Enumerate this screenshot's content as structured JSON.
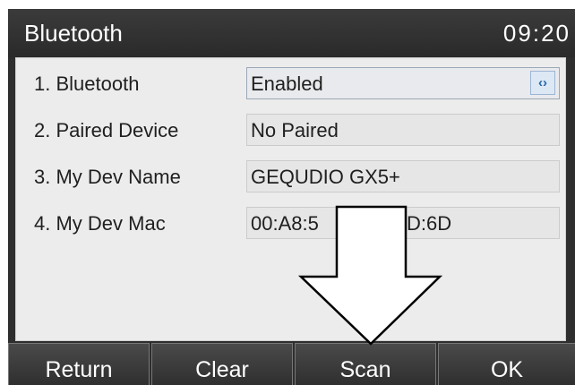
{
  "header": {
    "title": "Bluetooth",
    "time": "09:20"
  },
  "rows": [
    {
      "label": "1. Bluetooth",
      "value": "Enabled",
      "toggle_icon": "left-right-arrows-icon"
    },
    {
      "label": "2. Paired Device",
      "value": "No Paired"
    },
    {
      "label": "3. My Dev Name",
      "value": "GEQUDIO GX5+"
    },
    {
      "label": "4. My Dev Mac",
      "value": "00:A8:5",
      "value_tail": "D:6D"
    }
  ],
  "softkeys": [
    "Return",
    "Clear",
    "Scan",
    "OK"
  ],
  "overlay": {
    "icon": "down-arrow-icon",
    "stroke_color": "#000000",
    "fill_color": "#ffffff"
  }
}
